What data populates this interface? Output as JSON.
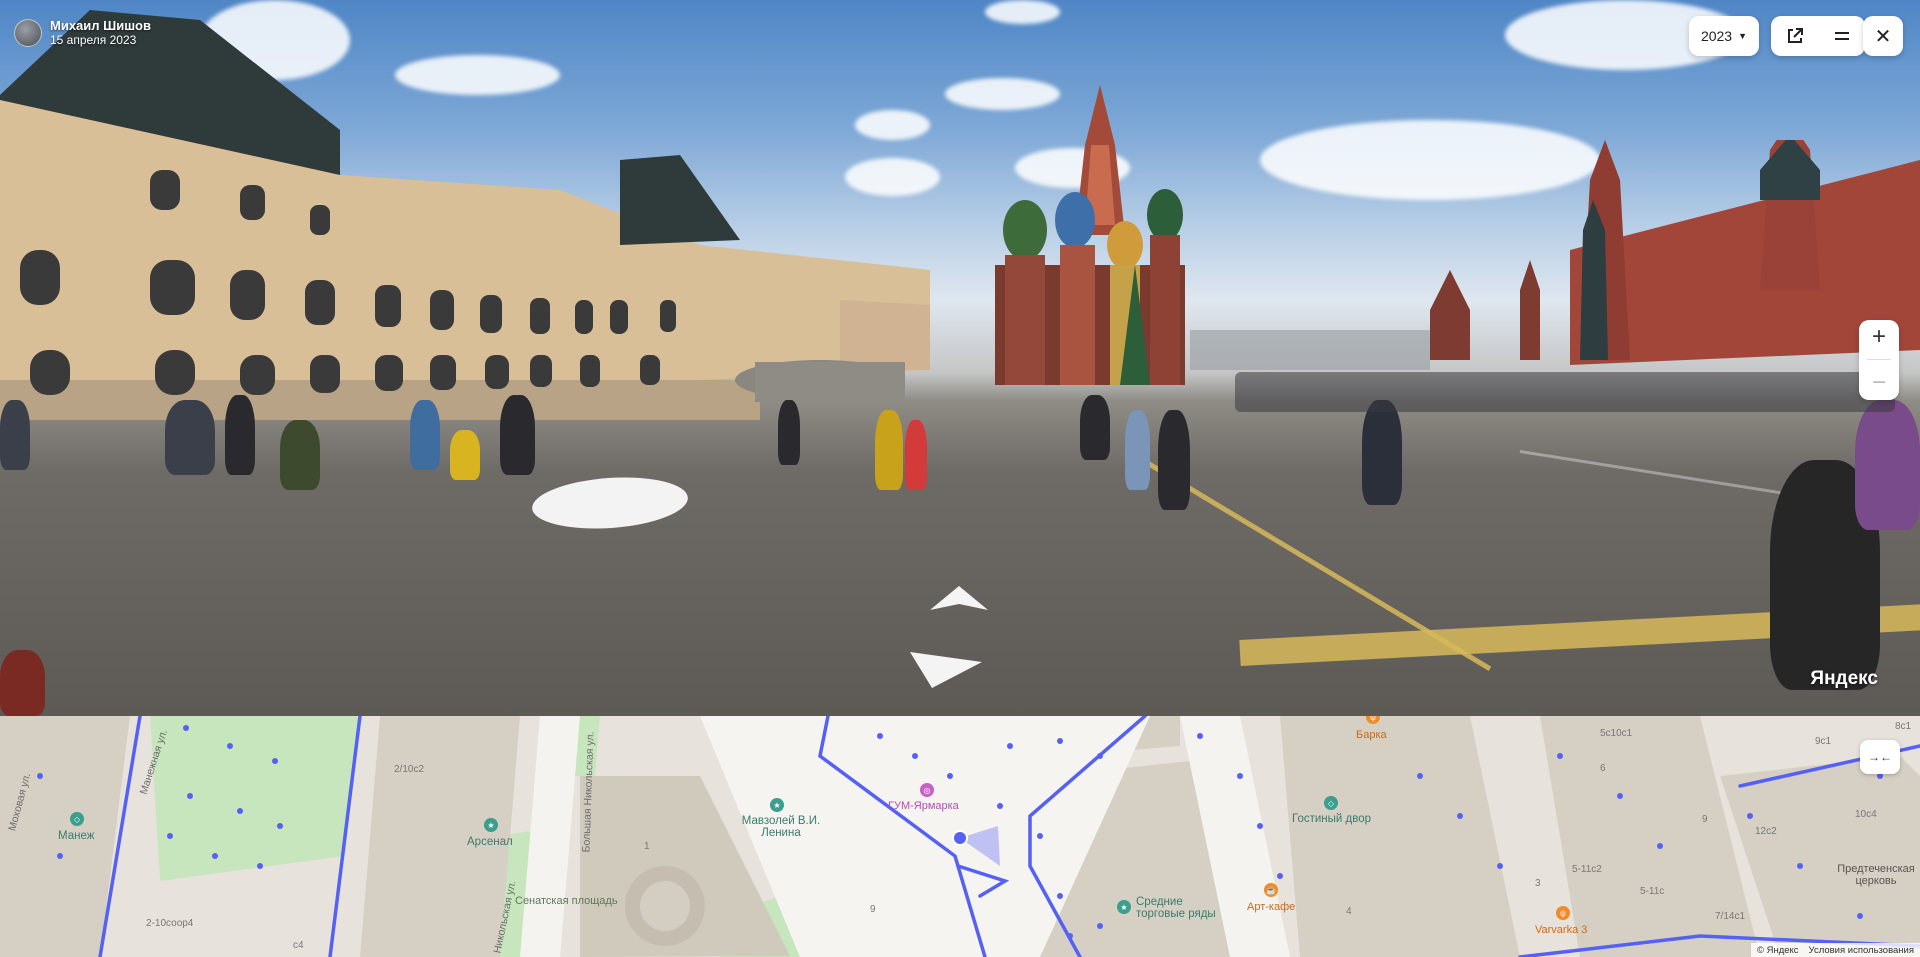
{
  "author": {
    "name": "Михаил Шишов",
    "date": "15 апреля 2023"
  },
  "controls": {
    "year": "2023",
    "zoom_in": "+",
    "zoom_out": "−",
    "close": "✕",
    "collapse": "→←"
  },
  "brand": "Яндекс",
  "map": {
    "streets": [
      "Моховая ул.",
      "Манежная ул.",
      "Большая Никольская ул.",
      "Никольская ул."
    ],
    "pois": {
      "manezh": "Манеж",
      "arsenal": "Арсенал",
      "senate_square": "Сенатская площадь",
      "mausoleum": "Мавзолей В.И. Ленина",
      "gum_fair": "ГУМ-Ярмарка",
      "gostiny_dvor": "Гостиный двор",
      "srednie_ryady": "Средние торговые ряды",
      "art_cafe": "Арт-кафе",
      "barka": "Барка",
      "varvarka": "Varvarka 3",
      "predtechenskaya": "Предтеченская церковь"
    },
    "house_numbers": [
      "2/10с2",
      "2-10соор4",
      "с4",
      "1",
      "9",
      "4",
      "5с10с1",
      "9с1",
      "6",
      "9",
      "10с4",
      "12с2",
      "5-11с2",
      "3",
      "5-11с",
      "7/14с1",
      "8с1"
    ],
    "footer": {
      "copyright": "© Яндекс",
      "terms": "Условия использования"
    }
  },
  "colors": {
    "route": "#5560f5",
    "poi_green": "#3c9e8c",
    "poi_orange": "#f08b2a",
    "poi_pink": "#c761c4"
  }
}
